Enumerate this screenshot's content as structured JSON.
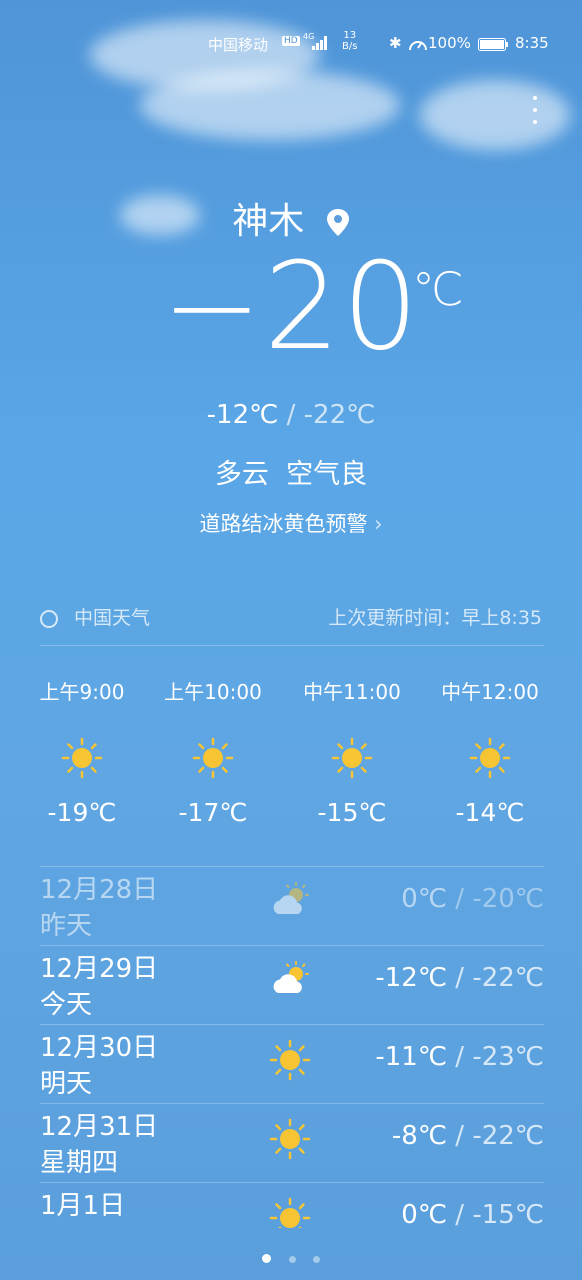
{
  "status_bar": {
    "carrier": "中国移动",
    "hd": "HD",
    "network": "4G",
    "speed": "13",
    "speed_unit": "B/s",
    "battery": "100%",
    "time": "8:35"
  },
  "location": {
    "city": "神木"
  },
  "current": {
    "temperature": "−20",
    "unit": "℃",
    "high": "-12℃",
    "low": "-22℃",
    "condition": "多云  空气良",
    "alert": "道路结冰黄色预警"
  },
  "source": {
    "name": "中国天气",
    "updated": "上次更新时间：早上8:35"
  },
  "hourly": [
    {
      "time": "上午9:00",
      "icon": "sun-icon",
      "temp": "-19℃"
    },
    {
      "time": "上午10:00",
      "icon": "sun-icon",
      "temp": "-17℃"
    },
    {
      "time": "中午11:00",
      "icon": "sun-icon",
      "temp": "-15℃"
    },
    {
      "time": "中午12:00",
      "icon": "sun-icon",
      "temp": "-14℃"
    }
  ],
  "daily": [
    {
      "date": "12月28日",
      "label": "昨天",
      "icon": "partly-cloudy-icon",
      "high": "0℃",
      "low": "-20℃"
    },
    {
      "date": "12月29日",
      "label": "今天",
      "icon": "partly-cloudy-icon",
      "high": "-12℃",
      "low": "-22℃"
    },
    {
      "date": "12月30日",
      "label": "明天",
      "icon": "sun-icon",
      "high": "-11℃",
      "low": "-23℃"
    },
    {
      "date": "12月31日",
      "label": "星期四",
      "icon": "sun-icon",
      "high": "-8℃",
      "low": "-22℃"
    },
    {
      "date": "1月1日",
      "label": "",
      "icon": "sun-icon",
      "high": "0℃",
      "low": "-15℃"
    }
  ],
  "colors": {
    "sun": "#f7c533",
    "accent": "#5aa6e6"
  }
}
